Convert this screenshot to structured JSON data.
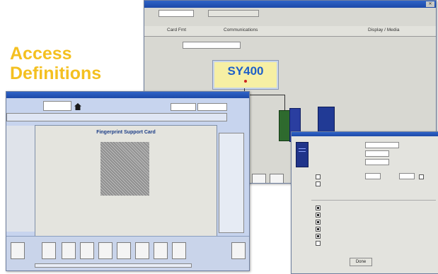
{
  "heading": {
    "line1": "Access",
    "line2": "Definitions"
  },
  "window_a": {
    "tabs": [
      "Card Fmt",
      "Communications",
      "",
      "Display / Media"
    ],
    "sy400_label": "SY400"
  },
  "window_b": {
    "dialog_title": "Fingerprint Support Card"
  },
  "window_c": {
    "checkboxes": [
      {
        "checked": true
      },
      {
        "checked": true
      },
      {
        "checked": true
      },
      {
        "checked": true
      },
      {
        "checked": true
      },
      {
        "checked": false
      }
    ],
    "ok_label": "Done"
  },
  "colors": {
    "heading": "#f4c020",
    "titlebar": "#1c49a8",
    "sy400_bg": "#f6efa4",
    "sy400_text": "#1e5fc8"
  }
}
